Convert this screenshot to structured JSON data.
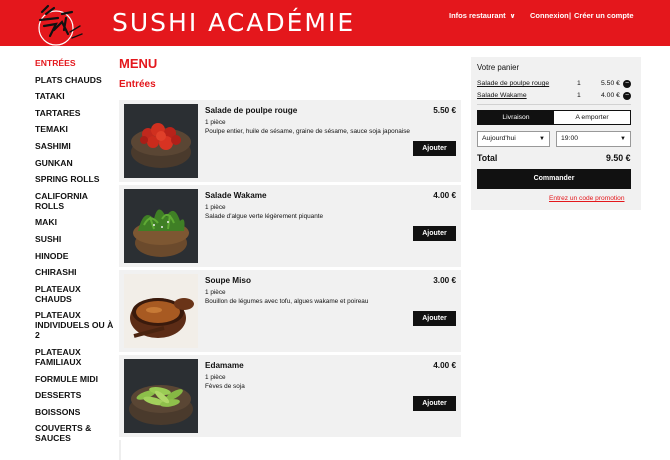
{
  "header": {
    "brand": "SUSHI ACADÉMIE",
    "info_label": "Infos restaurant",
    "login_label": "Connexion",
    "separator": "|",
    "create_account_label": "Créer un compte",
    "brand_color": "#e4171c"
  },
  "sidebar": {
    "items": [
      {
        "label": "ENTRÉES",
        "active": true
      },
      {
        "label": "PLATS CHAUDS"
      },
      {
        "label": "TATAKI"
      },
      {
        "label": "TARTARES"
      },
      {
        "label": "TEMAKI"
      },
      {
        "label": "SASHIMI"
      },
      {
        "label": "GUNKAN"
      },
      {
        "label": "SPRING ROLLS"
      },
      {
        "label": "CALIFORNIA ROLLS"
      },
      {
        "label": "MAKI"
      },
      {
        "label": "SUSHI"
      },
      {
        "label": "HINODE"
      },
      {
        "label": "CHIRASHI"
      },
      {
        "label": "PLATEAUX CHAUDS"
      },
      {
        "label": "PLATEAUX INDIVIDUELS OU À 2"
      },
      {
        "label": "PLATEAUX FAMILIAUX"
      },
      {
        "label": "FORMULE MIDI"
      },
      {
        "label": "DESSERTS"
      },
      {
        "label": "BOISSONS"
      },
      {
        "label": "COUVERTS & SAUCES"
      }
    ]
  },
  "main": {
    "title": "MENU",
    "section": "Entrées",
    "products": [
      {
        "name": "Salade de poulpe rouge",
        "price": "5.50 €",
        "qty": "1 pièce",
        "desc": "Poulpe entier, huile de sésame, graine de sésame, sauce soja japonaise",
        "button": "Ajouter",
        "image": "octopus-salad-image"
      },
      {
        "name": "Salade Wakame",
        "price": "4.00 €",
        "qty": "1 pièce",
        "desc": "Salade d'algue verte légèrement piquante",
        "button": "Ajouter",
        "image": "wakame-salad-image"
      },
      {
        "name": "Soupe Miso",
        "price": "3.00 €",
        "qty": "1 pièce",
        "desc": "Bouillon de légumes avec tofu, algues wakame et poireau",
        "button": "Ajouter",
        "image": "miso-soup-image"
      },
      {
        "name": "Edamame",
        "price": "4.00 €",
        "qty": "1 pièce",
        "desc": "Fèves de soja",
        "button": "Ajouter",
        "image": "edamame-image"
      }
    ]
  },
  "cart": {
    "title": "Votre panier",
    "lines": [
      {
        "name": "Salade de poulpe rouge",
        "qty": "1",
        "price": "5.50 €",
        "remove_icon": "minus-circle-icon"
      },
      {
        "name": "Salade Wakame",
        "qty": "1",
        "price": "4.00 €",
        "remove_icon": "minus-circle-icon"
      }
    ],
    "mode": {
      "delivery": "Livraison",
      "takeaway": "A emporter",
      "selected": "Livraison"
    },
    "day": "Aujourd'hui",
    "time": "19:00",
    "total_label": "Total",
    "total_value": "9.50 €",
    "order_button": "Commander",
    "promo_link": "Entrez un code promotion"
  }
}
